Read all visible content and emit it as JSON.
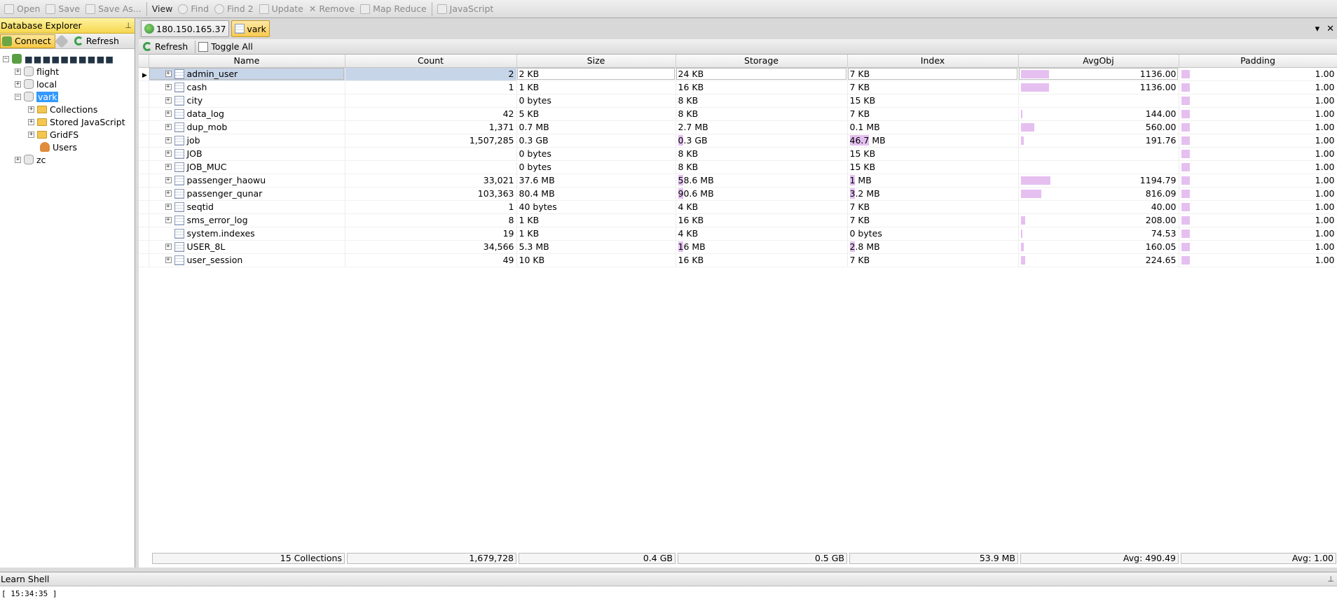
{
  "toolbar": {
    "items": [
      "Open",
      "Save",
      "Save As...",
      "View",
      "Find",
      "Find 2",
      "Update",
      "Remove",
      "Map Reduce",
      "JavaScript"
    ]
  },
  "explorer": {
    "title": "Database Explorer",
    "connect_label": "Connect",
    "refresh_label": "Refresh",
    "root_label": "■■■■■■■■■■",
    "databases": [
      "flight",
      "local",
      "vark",
      "zc"
    ],
    "vark_children": [
      "Collections",
      "Stored JavaScript",
      "GridFS",
      "Users"
    ]
  },
  "tabs": {
    "server_tab": "180.150.165.37",
    "db_tab": "vark"
  },
  "grid_toolbar": {
    "refresh_label": "Refresh",
    "toggle_label": "Toggle All"
  },
  "grid": {
    "headers": [
      "Name",
      "Count",
      "Size",
      "Storage",
      "Index",
      "AvgObj",
      "Padding"
    ],
    "rows": [
      {
        "name": "admin_user",
        "count": "2",
        "size": "2 KB",
        "storage_hl": "",
        "storage": "24 KB",
        "index_hl": "",
        "index": "7 KB",
        "avgobj": "1136.00",
        "avgobj_frac": 0.21,
        "padding": "1.00",
        "expandable": true
      },
      {
        "name": "cash",
        "count": "1",
        "size": "1 KB",
        "storage_hl": "",
        "storage": "16 KB",
        "index_hl": "",
        "index": "7 KB",
        "avgobj": "1136.00",
        "avgobj_frac": 0.21,
        "padding": "1.00",
        "expandable": true
      },
      {
        "name": "city",
        "count": "",
        "size": "0 bytes",
        "storage_hl": "",
        "storage": "8 KB",
        "index_hl": "",
        "index": "15 KB",
        "avgobj": "",
        "avgobj_frac": 0,
        "padding": "1.00",
        "expandable": true
      },
      {
        "name": "data_log",
        "count": "42",
        "size": "5 KB",
        "storage_hl": "",
        "storage": "8 KB",
        "index_hl": "",
        "index": "7 KB",
        "avgobj": "144.00",
        "avgobj_frac": 0.01,
        "padding": "1.00",
        "expandable": true
      },
      {
        "name": "dup_mob",
        "count": "1,371",
        "size": "0.7 MB",
        "storage_hl": "",
        "storage": "2.7 MB",
        "index_hl": "",
        "index": "0.1 MB",
        "avgobj": "560.00",
        "avgobj_frac": 0.1,
        "padding": "1.00",
        "expandable": true
      },
      {
        "name": "job",
        "count": "1,507,285",
        "size": "0.3 GB",
        "storage_hl": "0",
        "storage": ".3 GB",
        "index_hl": "46.7",
        "index": " MB",
        "avgobj": "191.76",
        "avgobj_frac": 0.02,
        "padding": "1.00",
        "expandable": true
      },
      {
        "name": "JOB",
        "count": "",
        "size": "0 bytes",
        "storage_hl": "",
        "storage": "8 KB",
        "index_hl": "",
        "index": "15 KB",
        "avgobj": "",
        "avgobj_frac": 0,
        "padding": "1.00",
        "expandable": true
      },
      {
        "name": "JOB_MUC",
        "count": "",
        "size": "0 bytes",
        "storage_hl": "",
        "storage": "8 KB",
        "index_hl": "",
        "index": "15 KB",
        "avgobj": "",
        "avgobj_frac": 0,
        "padding": "1.00",
        "expandable": true
      },
      {
        "name": "passenger_haowu",
        "count": "33,021",
        "size": "37.6 MB",
        "storage_hl": "5",
        "storage": "8.6 MB",
        "index_hl": "1",
        "index": " MB",
        "avgobj": "1194.79",
        "avgobj_frac": 0.22,
        "padding": "1.00",
        "expandable": true
      },
      {
        "name": "passenger_qunar",
        "count": "103,363",
        "size": "80.4 MB",
        "storage_hl": "9",
        "storage": "0.6 MB",
        "index_hl": "3",
        "index": ".2 MB",
        "avgobj": "816.09",
        "avgobj_frac": 0.15,
        "padding": "1.00",
        "expandable": true
      },
      {
        "name": "seqtid",
        "count": "1",
        "size": "40 bytes",
        "storage_hl": "",
        "storage": "4 KB",
        "index_hl": "",
        "index": "7 KB",
        "avgobj": "40.00",
        "avgobj_frac": 0,
        "padding": "1.00",
        "expandable": true
      },
      {
        "name": "sms_error_log",
        "count": "8",
        "size": "1 KB",
        "storage_hl": "",
        "storage": "16 KB",
        "index_hl": "",
        "index": "7 KB",
        "avgobj": "208.00",
        "avgobj_frac": 0.03,
        "padding": "1.00",
        "expandable": true
      },
      {
        "name": "system.indexes",
        "count": "19",
        "size": "1 KB",
        "storage_hl": "",
        "storage": "4 KB",
        "index_hl": "",
        "index": "0 bytes",
        "avgobj": "74.53",
        "avgobj_frac": 0.005,
        "padding": "1.00",
        "expandable": false
      },
      {
        "name": "USER_8L",
        "count": "34,566",
        "size": "5.3 MB",
        "storage_hl": "1",
        "storage": "6 MB",
        "index_hl": "2",
        "index": ".8 MB",
        "avgobj": "160.05",
        "avgobj_frac": 0.02,
        "padding": "1.00",
        "expandable": true
      },
      {
        "name": "user_session",
        "count": "49",
        "size": "10 KB",
        "storage_hl": "",
        "storage": "16 KB",
        "index_hl": "",
        "index": "7 KB",
        "avgobj": "224.65",
        "avgobj_frac": 0.03,
        "padding": "1.00",
        "expandable": true
      }
    ]
  },
  "footer": {
    "collections": "15 Collections",
    "count": "1,679,728",
    "size": "0.4 GB",
    "storage": "0.5 GB",
    "index": "53.9 MB",
    "avgobj": "Avg: 490.49",
    "padding": "Avg: 1.00"
  },
  "shell": {
    "title": "Learn Shell",
    "text": "[ 15:34:35 ]"
  }
}
